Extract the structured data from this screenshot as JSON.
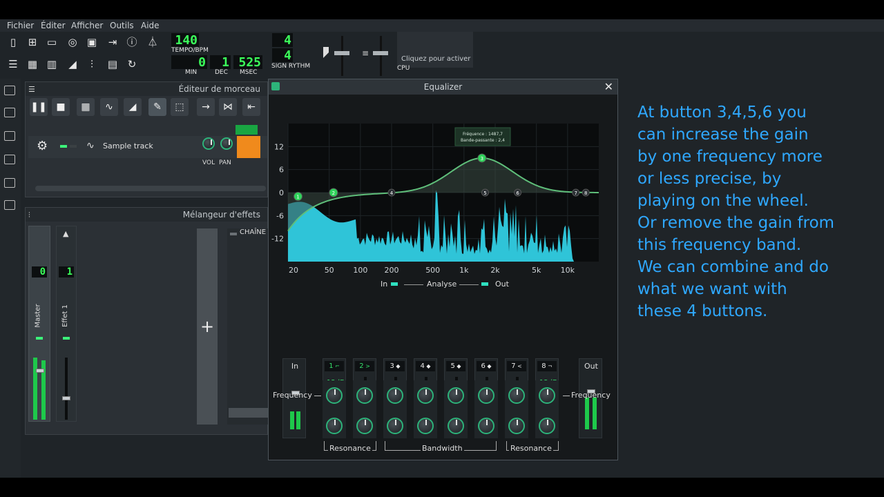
{
  "menu": {
    "file": "Fichier",
    "edit": "Éditer",
    "view": "Afficher",
    "tools": "Outils",
    "help": "Aide"
  },
  "transport": {
    "tempo": "140",
    "tempo_label": "TEMPO/BPM",
    "min": "0",
    "dec": "1",
    "msec": "525",
    "min_label": "MIN",
    "dec_label": "DEC",
    "msec_label": "MSEC",
    "sig_num": "4",
    "sig_den": "4",
    "sig_label": "SIGN RYTHM",
    "activate": "Cliquez pour activer",
    "cpu_label": "CPU"
  },
  "song_editor": {
    "title": "Éditeur de morceau",
    "track_name": "Sample track",
    "vol_label": "VOL",
    "pan_label": "PAN"
  },
  "mixer": {
    "title": "Mélangeur d'effets",
    "chain_label": "CHAÎNE",
    "master_label": "Master",
    "effect1_label": "Effet 1",
    "master_lcd": "0",
    "effect_lcd": "1",
    "add_label": "+"
  },
  "equalizer": {
    "title": "Equalizer",
    "tooltip_freq": "Fréquence : 1487,7",
    "tooltip_bw": "Bande-passante : 2,4",
    "y_ticks": [
      "12",
      "6",
      "0",
      "-6",
      "-12"
    ],
    "x_ticks": [
      "20",
      "50",
      "100",
      "200",
      "500",
      "1k",
      "2k",
      "5k",
      "10k"
    ],
    "analyse_in": "In",
    "analyse_label": "Analyse",
    "analyse_out": "Out",
    "in_label": "In",
    "out_label": "Out",
    "bands": [
      "1",
      "2",
      "3",
      "4",
      "5",
      "6",
      "7",
      "8"
    ],
    "slope_12": "12dB",
    "slope_24": "24dB",
    "slope_48": "48dB",
    "frequency_left": "Frequency",
    "frequency_right": "Frequency",
    "resonance_left": "Resonance",
    "bandwidth": "Bandwidth",
    "resonance_right": "Resonance",
    "curve_color": "#5fbf7a",
    "spectrum_color": "#2fc4d8",
    "node_color": "#2fd35a"
  },
  "caption": {
    "lines": [
      "At button 3,4,5,6 you",
      "can increase the gain",
      "by one frequency more",
      "or less precise, by",
      "playing on the wheel.",
      "Or remove the gain from",
      "this frequency band.",
      "We can combine and do",
      "what we want with",
      "these 4 buttons."
    ],
    "color": "#2fa8ff"
  }
}
